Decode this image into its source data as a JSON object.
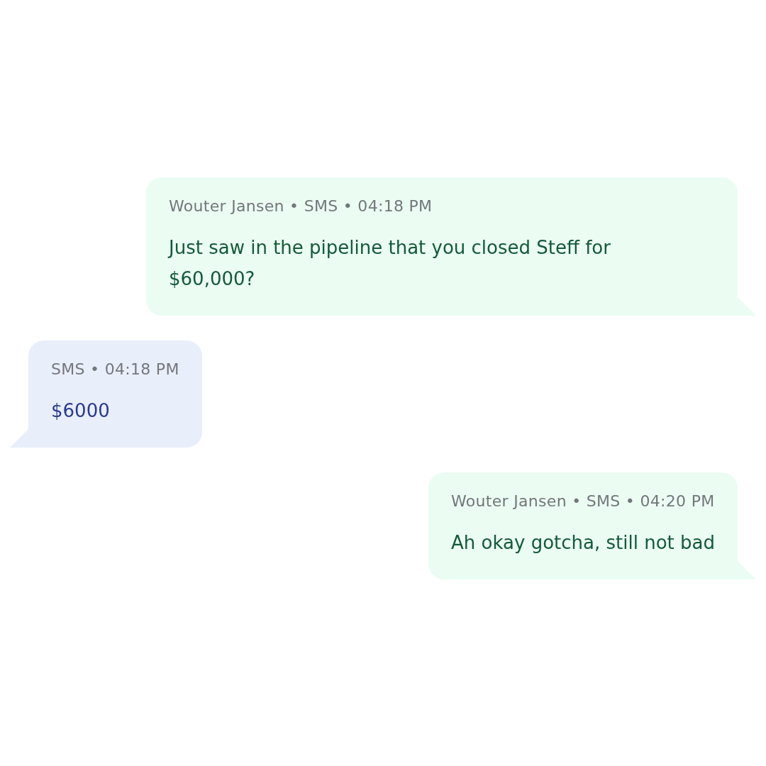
{
  "messages": [
    {
      "kind": "outgoing",
      "meta": "Wouter Jansen • SMS • 04:18 PM",
      "text": "Just saw in the pipeline that you closed Steff for $60,000?"
    },
    {
      "kind": "incoming",
      "meta": "SMS • 04:18 PM",
      "text": "$6000"
    },
    {
      "kind": "outgoing",
      "meta": "Wouter Jansen • SMS • 04:20 PM",
      "text": "Ah okay gotcha, still not bad"
    }
  ]
}
